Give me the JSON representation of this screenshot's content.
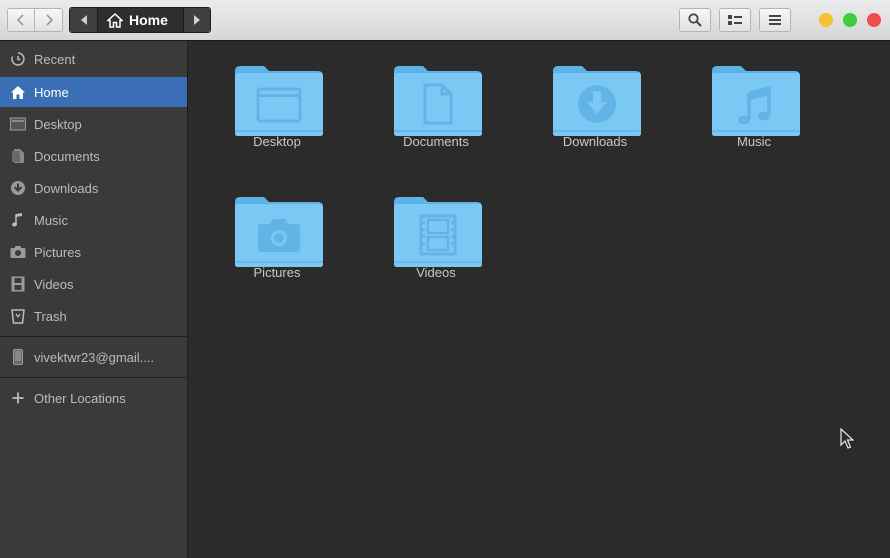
{
  "header": {
    "path_label": "Home"
  },
  "sidebar": {
    "items": [
      {
        "label": "Recent",
        "icon": "clock-icon"
      },
      {
        "label": "Home",
        "icon": "home-icon"
      },
      {
        "label": "Desktop",
        "icon": "desktop-icon"
      },
      {
        "label": "Documents",
        "icon": "document-icon"
      },
      {
        "label": "Downloads",
        "icon": "download-icon"
      },
      {
        "label": "Music",
        "icon": "music-icon"
      },
      {
        "label": "Pictures",
        "icon": "camera-icon"
      },
      {
        "label": "Videos",
        "icon": "film-icon"
      },
      {
        "label": "Trash",
        "icon": "trash-icon"
      }
    ],
    "account": {
      "label": "vivektwr23@gmail....",
      "icon": "phone-icon"
    },
    "other_locations": {
      "label": "Other Locations",
      "icon": "plus-icon"
    }
  },
  "main": {
    "folders": [
      {
        "label": "Desktop",
        "icon": "folder-desktop-icon"
      },
      {
        "label": "Documents",
        "icon": "folder-documents-icon"
      },
      {
        "label": "Downloads",
        "icon": "folder-downloads-icon"
      },
      {
        "label": "Music",
        "icon": "folder-music-icon"
      },
      {
        "label": "Pictures",
        "icon": "folder-pictures-icon"
      },
      {
        "label": "Videos",
        "icon": "folder-videos-icon"
      }
    ]
  },
  "colors": {
    "accent": "#3a6fb5",
    "folder": "#7cc8f4",
    "folder_dark": "#5ab4e8"
  }
}
